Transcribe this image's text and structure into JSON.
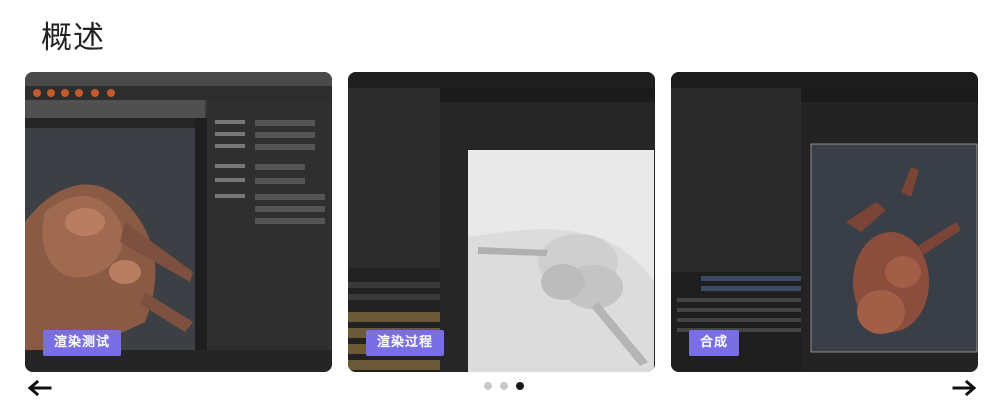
{
  "page": {
    "title": "概述"
  },
  "carousel": {
    "slides": [
      {
        "caption": "渲染测试"
      },
      {
        "caption": "渲染过程"
      },
      {
        "caption": "合成"
      }
    ],
    "active_index": 2,
    "dot_count": 3,
    "prev_icon": "arrow-left-icon",
    "next_icon": "arrow-right-icon"
  },
  "colors": {
    "badge": "#7a6ee6",
    "dot_active": "#1a1a1a",
    "dot_inactive": "#c8c8c8"
  }
}
